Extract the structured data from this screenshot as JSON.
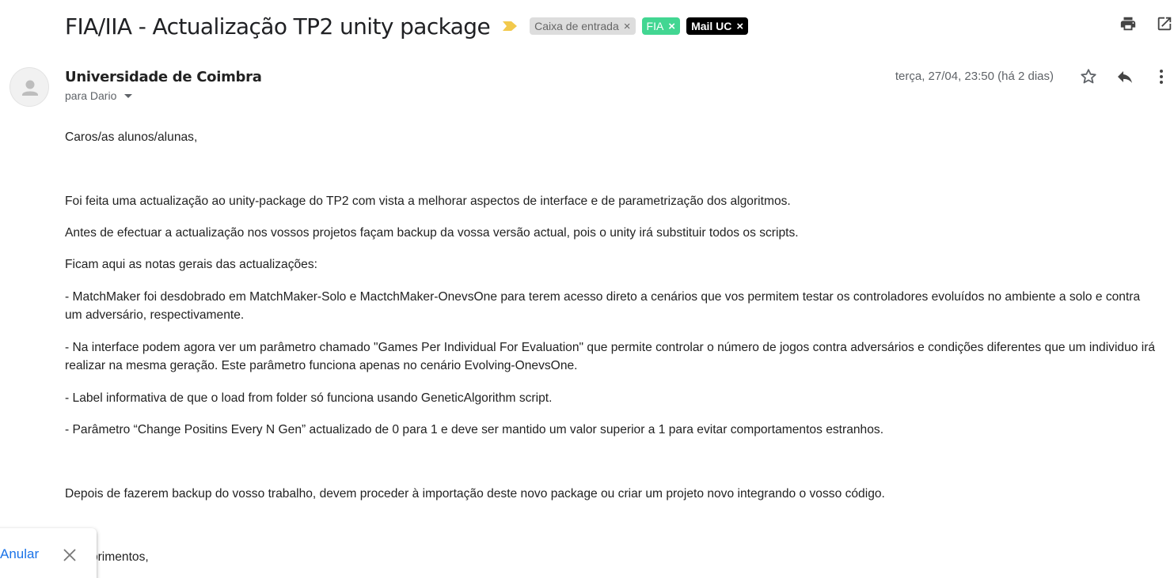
{
  "email": {
    "subject": "FIA/IIA - Actualização TP2 unity package",
    "labels": [
      {
        "text": "Caixa de entrada",
        "color": "#dddddd"
      },
      {
        "text": "FIA",
        "color": "#42d692"
      },
      {
        "text": "Mail UC",
        "color": "#000000"
      }
    ],
    "sender": "Universidade de Coimbra",
    "to": "para Dario",
    "date": "terça, 27/04, 23:50 (há 2 dias)",
    "body": [
      "Caros/as alunos/alunas,",
      "Foi feita uma actualização ao unity-package do TP2 com vista a melhorar aspectos de interface e de parametrização dos algoritmos.",
      "Antes de efectuar a actualização nos vossos projetos façam backup da vossa versão actual, pois o unity irá substituir todos os scripts.",
      "Ficam aqui as notas gerais das actualizações:",
      "- MatchMaker foi desdobrado em MatchMaker-Solo e MactchMaker-OnevsOne para terem acesso direto a cenários que vos permitem testar os controladores evoluídos no ambiente a solo e contra um adversário, respectivamente.",
      "- Na interface podem agora ver um parâmetro chamado \"Games Per Individual For Evaluation\" que permite controlar o número de jogos contra adversários e condições diferentes que um individuo irá realizar na mesma geração.  Este parâmetro funciona apenas no cenário Evolving-OnevsOne.",
      "- Label informativa de que o load from folder só funciona usando GeneticAlgorithm script.",
      "- Parâmetro “Change Positins Every N Gen” actualizado de 0 para 1 e deve ser mantido um valor superior a 1 para evitar comportamentos estranhos.",
      "Depois de fazerem backup do vosso trabalho, devem proceder à importação deste novo package ou criar um projeto novo integrando o vosso código.",
      "Cumprimentos,"
    ]
  },
  "toast": {
    "undo_label": "Anular"
  },
  "icons": {
    "importance": "importance-marker-icon",
    "print": "print-icon",
    "open_new_window": "open-in-new-window-icon",
    "avatar": "default-avatar-icon",
    "star": "star-icon",
    "reply": "reply-icon",
    "more": "more-vertical-icon",
    "close": "close-icon"
  },
  "colors": {
    "importance": "#f2c94c",
    "link": "#1a73e8"
  }
}
